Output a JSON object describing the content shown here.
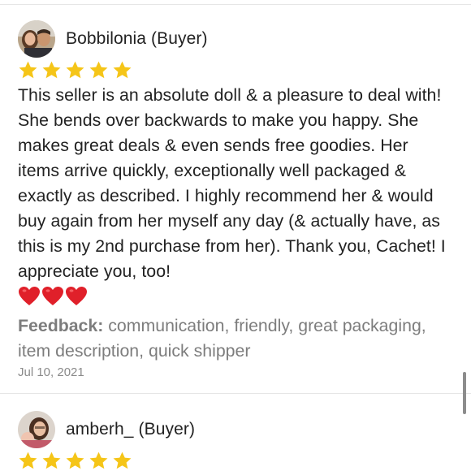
{
  "reviews": [
    {
      "reviewer": "Bobbilonia (Buyer)",
      "rating": 5,
      "text": "This seller is an absolute doll & a pleasure to deal with! She bends over backwards to make you happy. She makes great deals & even sends free goodies. Her items arrive quickly, exceptionally well packaged & exactly as described. I highly recommend her & would buy again from her myself any day (& actually have, as this is my 2nd purchase from her). Thank you, Cachet! I appreciate you, too!",
      "hearts": "❤️❤️❤️",
      "feedback_label": "Feedback:",
      "feedback_tags": "communication, friendly, great packaging, item description, quick shipper",
      "date": "Jul 10, 2021"
    },
    {
      "reviewer": "amberh_ (Buyer)",
      "rating": 5
    }
  ],
  "colors": {
    "star": "#f5c518",
    "heart": "#e0202a",
    "muted_text": "#7d7d7d",
    "divider": "#e6e6e6"
  },
  "icons": {
    "star": "star-icon",
    "heart": "heart-icon"
  }
}
